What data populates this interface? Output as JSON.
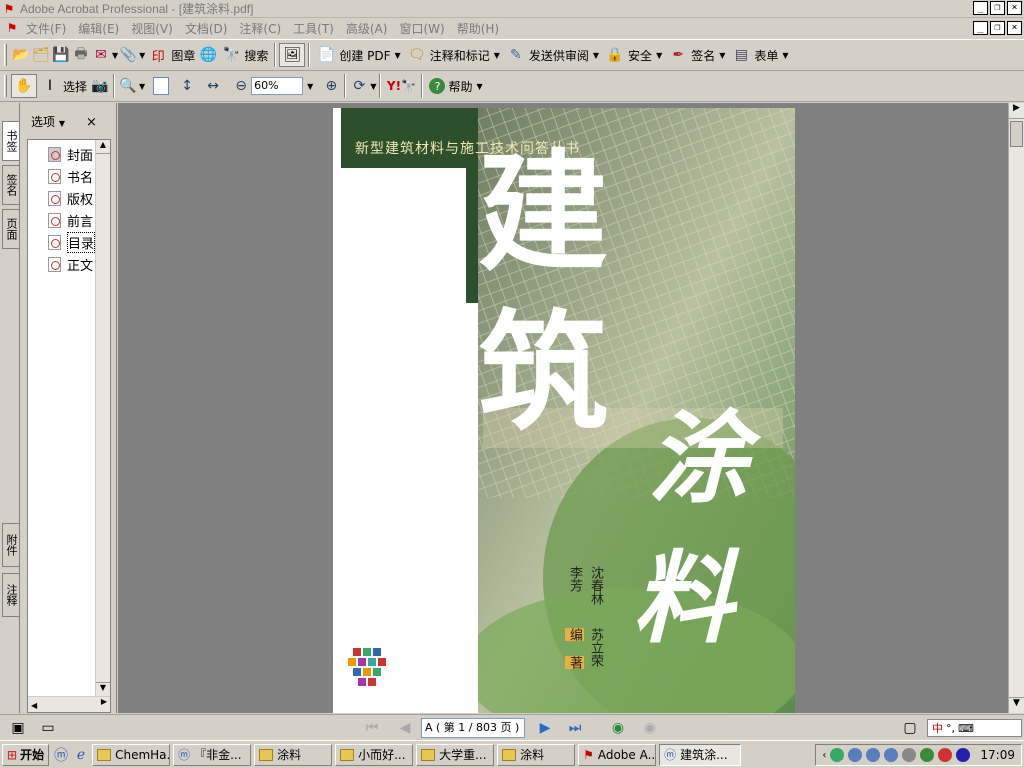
{
  "window": {
    "title": "Adobe Acrobat Professional - [建筑涂料.pdf]"
  },
  "menu": [
    "文件(F)",
    "编辑(E)",
    "视图(V)",
    "文档(D)",
    "注释(C)",
    "工具(T)",
    "高级(A)",
    "窗口(W)",
    "帮助(H)"
  ],
  "toolbar1": {
    "stamp": "图章",
    "search": "搜索",
    "create_pdf": "创建 PDF",
    "comment": "注释和标记",
    "review": "发送供审阅",
    "security": "安全",
    "sign": "签名",
    "forms": "表单"
  },
  "toolbar2": {
    "select": "选择",
    "zoom": "60%",
    "help": "帮助"
  },
  "left_tabs": [
    "书签",
    "签名",
    "页面",
    "附件",
    "注释"
  ],
  "nav": {
    "options": "选项",
    "close": "×",
    "bookmarks": [
      "封面",
      "书名",
      "版权",
      "前言",
      "目录",
      "正文"
    ]
  },
  "cover": {
    "series": "新型建筑材料与施工技术问答丛书",
    "title_line1": "建",
    "title_line2": "筑",
    "title_line3": "涂",
    "title_line4": "料",
    "authors_col1": "沈春林",
    "authors_col2": "苏立荣",
    "editor": "李芳",
    "role1": "编",
    "role2": "著",
    "colors": {
      "dark_green": "#2d4f2c",
      "mid_green": "#6c9a4e",
      "bright": "#e8e0c8"
    }
  },
  "status": {
    "page": "A ( 第 1 / 803 页 )"
  },
  "taskbar": {
    "start": "开始",
    "tasks": [
      "ChemHa...",
      "『非金...",
      "涂料",
      "小而好...",
      "大学重...",
      "涂料",
      "Adobe A...",
      "建筑涂..."
    ],
    "ime": "中",
    "clock": "17:09"
  }
}
